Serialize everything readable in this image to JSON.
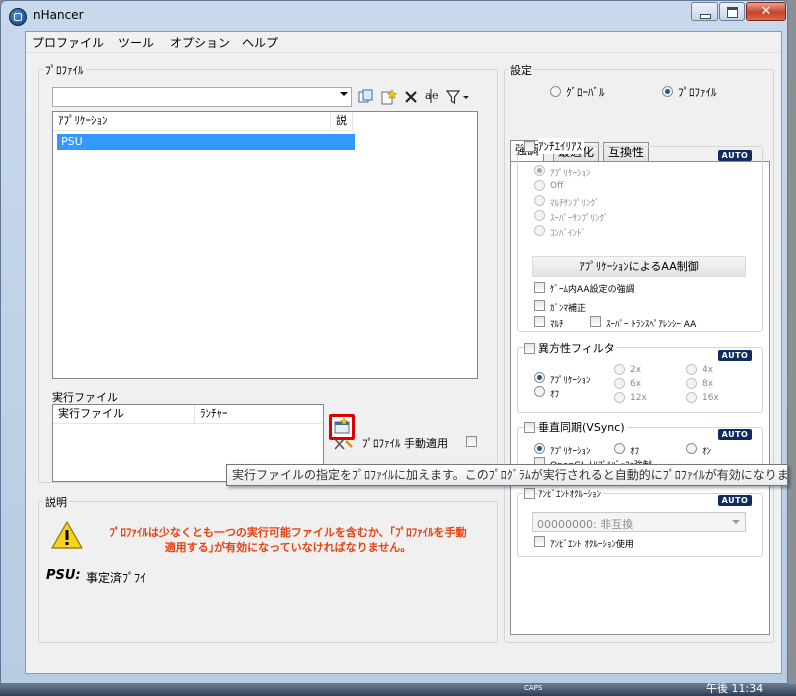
{
  "window": {
    "title": "nHancer",
    "minimize": "",
    "maximize": "",
    "close": "✕"
  },
  "menu": [
    "プロファイル",
    "ツール",
    "オプション",
    "ヘルプ"
  ],
  "profile_group": {
    "label": "ﾌﾟﾛﾌｧｲﾙ",
    "combo_value": "",
    "toolbar_icons": [
      "copy-icon",
      "new-profile-icon",
      "delete-icon",
      "rename-icon",
      "filter-icon"
    ],
    "list_columns": [
      "ｱﾌﾟﾘｹｰｼｮﾝ",
      "説"
    ],
    "list_rows": [
      "PSU"
    ]
  },
  "exec_group": {
    "label": "実行ファイル",
    "columns": [
      "実行ファイル",
      "ﾗﾝﾁｬｰ"
    ],
    "manual_apply_label": "ﾌﾟﾛﾌｧｲﾙ 手動適用"
  },
  "description": {
    "label": "説明",
    "warning": "ﾌﾟﾛﾌｧｲﾙは少なくとも一つの実行可能ファイルを含むか、｢ﾌﾟﾛﾌｧｲﾙを手動適用する｣が有効になっていなければなりません。",
    "profile_name": "PSU:",
    "profile_desc": "事定済ﾌﾟﾌｲ"
  },
  "settings": {
    "label": "設定",
    "scope_global": "ｸﾞﾛｰﾊﾞﾙ",
    "scope_profile": "ﾌﾟﾛﾌｧｲﾙ",
    "tabs": [
      "強調",
      "最適化",
      "互換性"
    ],
    "auto_badge": "AUTO",
    "aa": {
      "title": "ｱﾝﾁｴｲﾘｱｽ",
      "options": [
        "ｱﾌﾟﾘｹｰｼｮﾝ",
        "Off",
        "ﾏﾙﾁｻﾝﾌﾟﾘﾝｸﾞ",
        "ｽｰﾊﾟｰｻﾝﾌﾟﾘﾝｸﾞ",
        "ｺﾝﾊﾞｲﾝﾄﾞ"
      ],
      "app_control_button": "ｱﾌﾟﾘｹｰｼｮﾝによるAA制御",
      "ingame_enhance": "ｹﾞｰﾑ内AA設定の強調",
      "gamma": "ｶﾞﾝﾏ補正",
      "multi": "ﾏﾙﾁ",
      "super_transparency": "ｽｰﾊﾟｰ ﾄﾗﾝｽﾍﾟｱﾚﾝｼｰ AA"
    },
    "af": {
      "title": "異方性フィルタ",
      "options": [
        "ｱﾌﾟﾘｹｰｼｮﾝ",
        "ｵﾌ",
        "2x",
        "6x",
        "12x",
        "4x",
        "8x",
        "16x"
      ]
    },
    "vsync": {
      "title": "垂直同期(VSync)",
      "options": [
        "ｱﾌﾟﾘｹｰｼｮﾝ",
        "ｵﾌ",
        "ｵﾝ"
      ],
      "opengl_partial": "OpenGL ﾄﾘﾌﾟﾙﾊﾞｯﾌｧ強制"
    },
    "ao": {
      "title": "ｱﾝﾋﾞｴﾝﾄｵｸﾙｰｼｮﾝ",
      "combo_value": "00000000: 非互換",
      "use_label": "ｱﾝﾋﾞｴﾝﾄ ｵｸﾙｰｼｮﾝ使用"
    }
  },
  "tooltip": "実行ファイルの指定をﾌﾟﾛﾌｧｲﾙに加えます。このﾌﾟﾛｸﾞﾗﾑが実行されると自動的にﾌﾟﾛﾌｧｲﾙが有効になります。",
  "taskbar": {
    "caps": "CAPS",
    "clock": "午後 11:34"
  },
  "colors": {
    "selection": "#3399ff",
    "warning_text": "#e8420f",
    "auto_badge": "#102c5e",
    "highlight_box": "#e00000"
  }
}
